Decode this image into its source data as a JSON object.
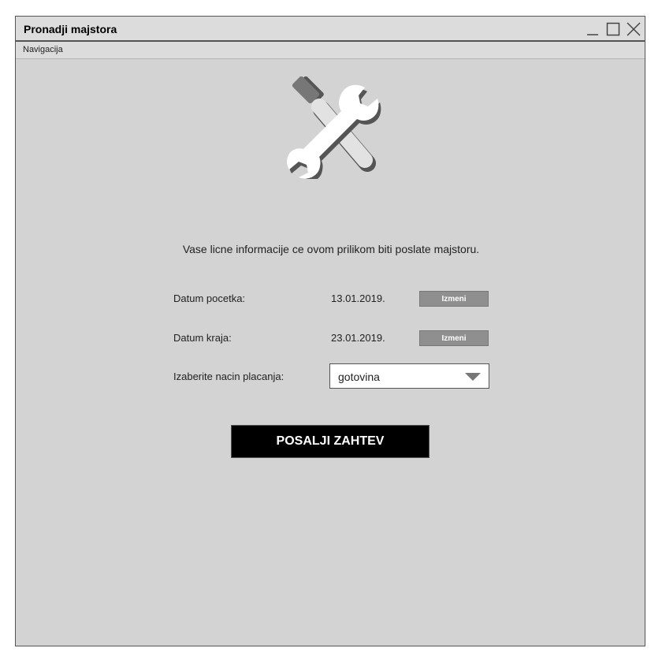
{
  "window": {
    "title": "Pronadji majstora",
    "controls": [
      "minimize-icon",
      "maximize-icon",
      "close-icon"
    ]
  },
  "menu": {
    "navigation": "Navigacija"
  },
  "logo": {
    "icon": "tools-icon"
  },
  "notice": "Vase licne informacije ce ovom prilikom biti poslate majstoru.",
  "form": {
    "start_date": {
      "label": "Datum pocetka:",
      "value": "13.01.2019.",
      "button": "Izmeni"
    },
    "end_date": {
      "label": "Datum kraja:",
      "value": "23.01.2019.",
      "button": "Izmeni"
    },
    "payment": {
      "label": "Izaberite nacin placanja:",
      "selected": "gotovina"
    }
  },
  "submit_label": "POSALJI ZAHTEV",
  "colors": {
    "background": "#d3d3d3",
    "titlebar": "#dcdcdc",
    "button_gray": "#8f8f8f",
    "submit_bg": "#000000"
  }
}
